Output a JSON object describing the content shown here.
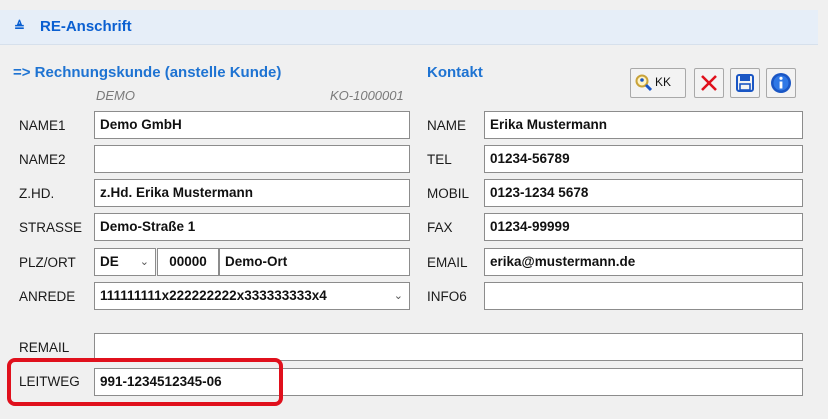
{
  "section": {
    "title": "RE-Anschrift"
  },
  "left": {
    "heading": "=> Rechnungskunde (anstelle Kunde)",
    "customer_code": "DEMO",
    "customer_number": "KO-1000001",
    "labels": {
      "name1": "NAME1",
      "name2": "NAME2",
      "zhd": "Z.HD.",
      "strasse": "STRASSE",
      "plzort": "PLZ/ORT",
      "anrede": "ANREDE",
      "remail": "REMAIL",
      "leitweg": "LEITWEG"
    },
    "values": {
      "name1": "Demo GmbH",
      "name2": "",
      "zhd": "z.Hd. Erika Mustermann",
      "strasse": "Demo-Straße 1",
      "country": "DE",
      "plz": "00000",
      "ort": "Demo-Ort",
      "anrede": "111111111x222222222x333333333x4",
      "remail": "",
      "leitweg": "991-1234512345-06"
    }
  },
  "right": {
    "heading": "Kontakt",
    "labels": {
      "name": "NAME",
      "tel": "TEL",
      "mobil": "MOBIL",
      "fax": "FAX",
      "email": "EMAIL",
      "info6": "INFO6"
    },
    "values": {
      "name": "Erika Mustermann",
      "tel": "01234-56789",
      "mobil": "0123-1234 5678",
      "fax": "01234-99999",
      "email": "erika@mustermann.de",
      "info6": ""
    }
  },
  "toolbar": {
    "kk_label": "KK"
  },
  "icons": {
    "collapse": "double-chevron-icon",
    "search": "search-person-icon",
    "delete": "close-x-icon",
    "save": "floppy-disk-icon",
    "info": "info-icon"
  },
  "colors": {
    "accent": "#1e73d2",
    "header_bg": "#e6eef8",
    "delete_red": "#e0101c",
    "save_blue": "#1a56c4",
    "highlight": "#e0101c"
  }
}
